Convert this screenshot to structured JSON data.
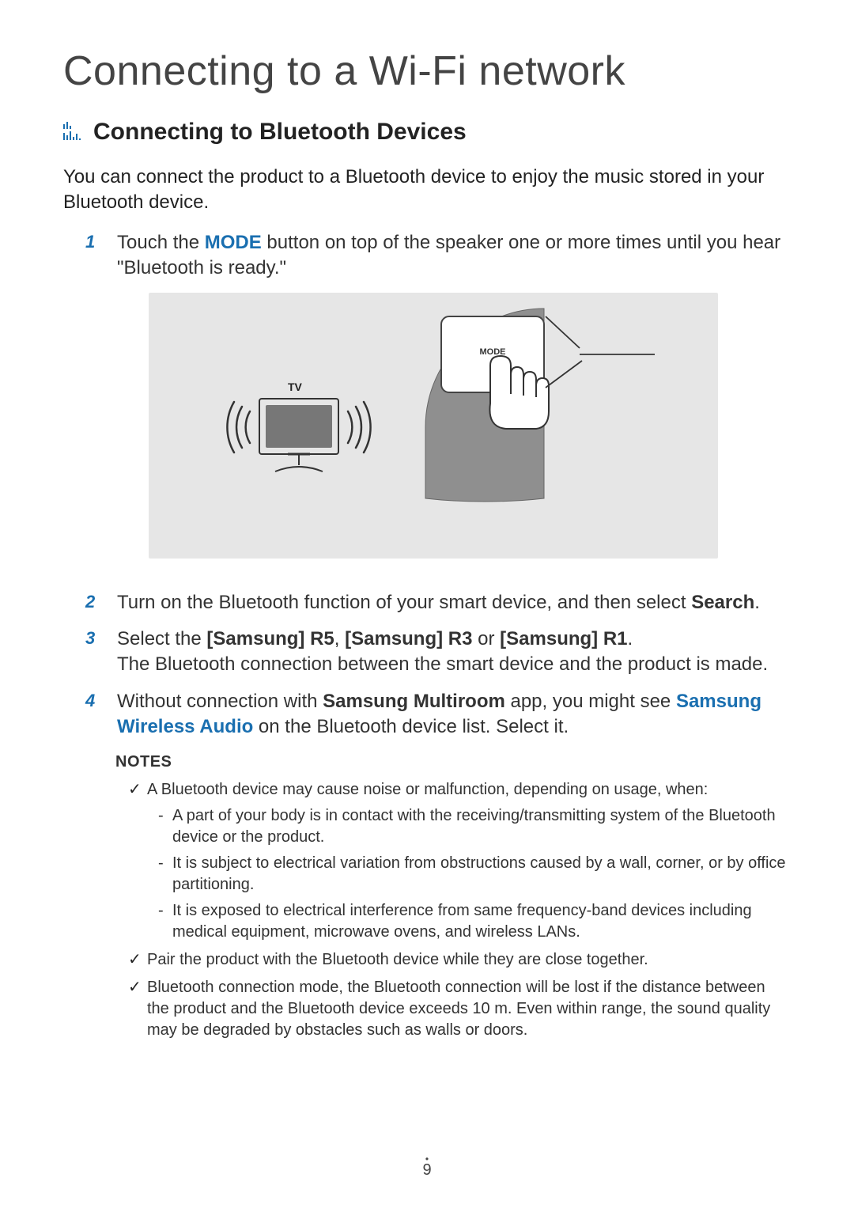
{
  "title": "Connecting to a Wi-Fi network",
  "section_title": "Connecting to Bluetooth Devices",
  "intro": "You can connect the product to a Bluetooth device to enjoy the music stored in your Bluetooth device.",
  "steps": {
    "s1": {
      "num": "1",
      "pre": "Touch the ",
      "mode": "MODE",
      "post": " button on top of the speaker one or more times until you hear \"Bluetooth is ready.\""
    },
    "s2": {
      "num": "2",
      "pre": "Turn on the Bluetooth function of your smart device, and then select ",
      "search": "Search",
      "post": "."
    },
    "s3": {
      "num": "3",
      "pre": "Select the ",
      "r5": "[Samsung] R5",
      "c1": ", ",
      "r3": "[Samsung] R3",
      "c2": " or ",
      "r1": "[Samsung] R1",
      "c3": ".",
      "line2": "The Bluetooth connection between the smart device and the product is made."
    },
    "s4": {
      "num": "4",
      "pre": "Without connection with ",
      "app": "Samsung Multiroom",
      "mid": " app, you might see ",
      "swa": "Samsung Wireless Audio",
      "post": " on the Bluetooth device list. Select it."
    }
  },
  "figure": {
    "tv_label": "TV",
    "mode_label": "MODE"
  },
  "notes_heading": "NOTES",
  "notes": {
    "n1": {
      "text": "A Bluetooth device may cause noise or malfunction, depending on usage, when:",
      "sub1": "A part of your body is in contact with the receiving/transmitting system of the Bluetooth device or the product.",
      "sub2": "It is subject to electrical variation from obstructions caused by a wall, corner, or by office partitioning.",
      "sub3": "It is exposed to electrical interference from same frequency-band devices including medical equipment, microwave ovens, and wireless LANs."
    },
    "n2": "Pair the product with the Bluetooth device while they are close together.",
    "n3": "Bluetooth connection mode, the Bluetooth connection will be lost if the distance between the product and the Bluetooth device exceeds 10 m. Even within range, the sound quality may be degraded by obstacles such as walls or doors."
  },
  "page_number": "9"
}
